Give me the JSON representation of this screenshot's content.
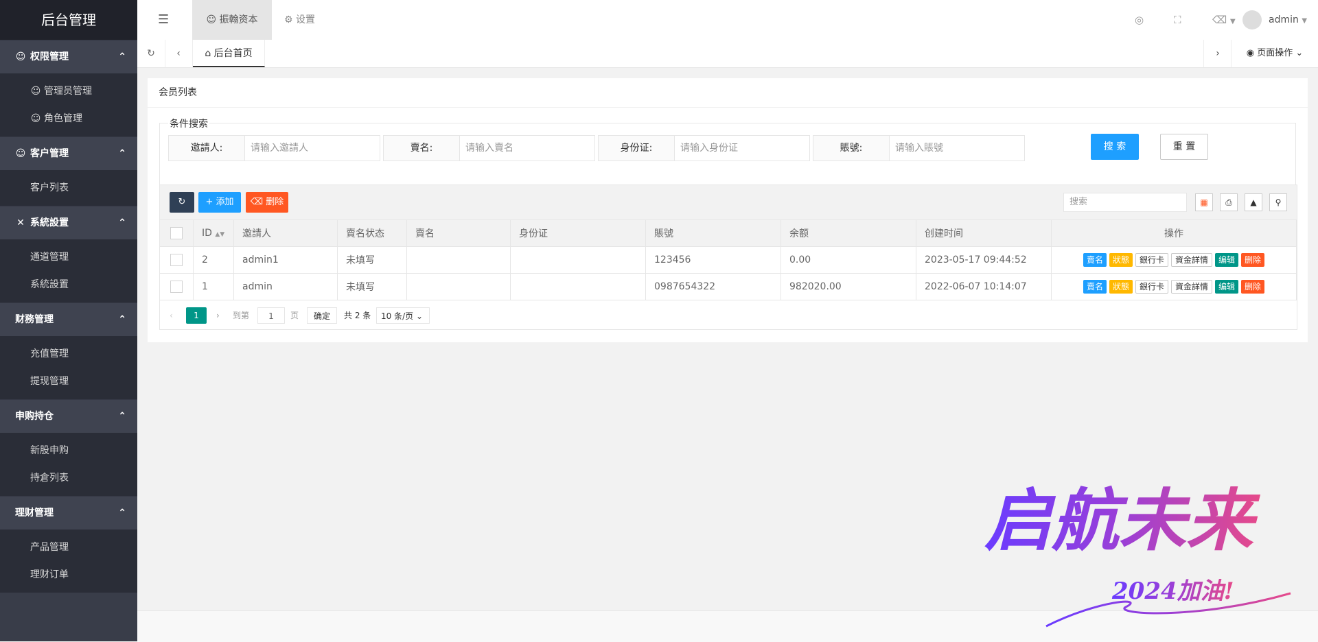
{
  "sidebar": {
    "logo": "后台管理",
    "groups": [
      {
        "title": "权限管理",
        "icon": "person-icon",
        "items": [
          {
            "label": "管理员管理"
          },
          {
            "label": "角色管理"
          }
        ]
      },
      {
        "title": "客户管理",
        "icon": "person-icon",
        "items": [
          {
            "label": "客户列表"
          }
        ]
      },
      {
        "title": "系統設置",
        "icon": "tools-icon",
        "items": [
          {
            "label": "通道管理"
          },
          {
            "label": "系統設置"
          }
        ]
      },
      {
        "title": "财務管理",
        "icon": "",
        "items": [
          {
            "label": "充值管理"
          },
          {
            "label": "提现管理"
          }
        ]
      },
      {
        "title": "申购持仓",
        "icon": "",
        "items": [
          {
            "label": "新股申购"
          },
          {
            "label": "持倉列表"
          }
        ]
      },
      {
        "title": "理财管理",
        "icon": "",
        "items": [
          {
            "label": "产品管理"
          },
          {
            "label": "理财订单"
          }
        ]
      }
    ]
  },
  "header": {
    "tab_active": "振翰资本",
    "tab_settings": "设置",
    "user": "admin"
  },
  "tabsbar": {
    "home_tab": "后台首页",
    "page_ops": "页面操作"
  },
  "card": {
    "title": "会员列表",
    "search": {
      "legend": "条件搜索",
      "fields": [
        {
          "label": "邀請人:",
          "placeholder": "请输入邀請人"
        },
        {
          "label": "賣名:",
          "placeholder": "请输入賣名"
        },
        {
          "label": "身份证:",
          "placeholder": "请输入身份证"
        },
        {
          "label": "賬號:",
          "placeholder": "请输入賬號"
        }
      ],
      "search_btn": "搜 索",
      "reset_btn": "重 置"
    },
    "toolbar": {
      "add": "添加",
      "delete": "删除",
      "search_placeholder": "搜索"
    },
    "table": {
      "headers": [
        "ID",
        "邀請人",
        "賣名状态",
        "賣名",
        "身份证",
        "賬號",
        "余额",
        "创建时间",
        "操作"
      ],
      "rows": [
        {
          "id": "2",
          "inviter": "admin1",
          "status": "未填写",
          "name": "",
          "idcard": "",
          "account": "123456",
          "balance": "0.00",
          "created": "2023-05-17 09:44:52"
        },
        {
          "id": "1",
          "inviter": "admin",
          "status": "未填写",
          "name": "",
          "idcard": "",
          "account": "0987654322",
          "balance": "982020.00",
          "created": "2022-06-07 10:14:07"
        }
      ],
      "ops": [
        "賣名",
        "狀態",
        "銀行卡",
        "資金詳情",
        "编辑",
        "删除"
      ]
    },
    "pager": {
      "current": "1",
      "goto_label": "到第",
      "page_input": "1",
      "page_suffix": "页",
      "confirm": "确定",
      "total": "共 2 条",
      "page_size": "10 条/页"
    }
  },
  "watermark": {
    "main": "启航未来",
    "sub": "2024加油!"
  },
  "colors": {
    "sidebar_bg": "#393d49",
    "primary_blue": "#1e9fff",
    "danger": "#ff5722",
    "success": "#009688",
    "warning": "#ffb800"
  }
}
